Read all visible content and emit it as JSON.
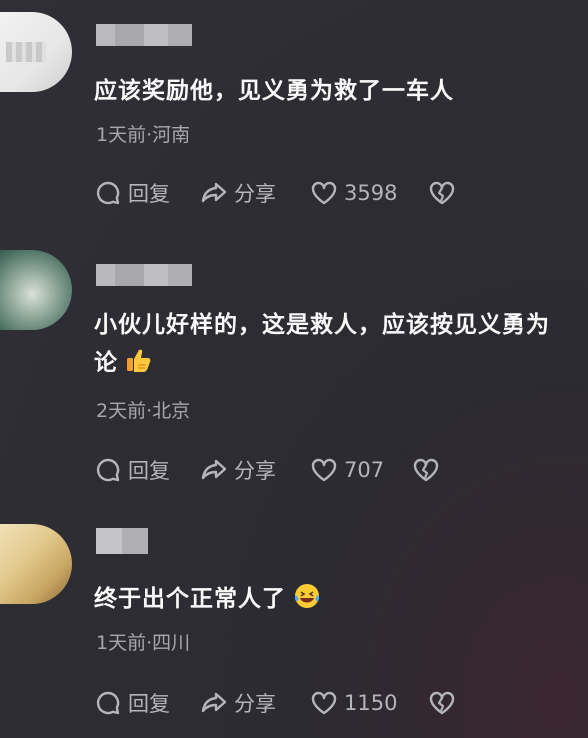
{
  "comments": [
    {
      "text": "应该奖励他，见义勇为救了一车人",
      "meta": "1天前·河南",
      "reply": "回复",
      "share": "分享",
      "likes": "3598"
    },
    {
      "text": "小伙儿好样的，这是救人，应该按见义勇为论",
      "meta": "2天前·北京",
      "reply": "回复",
      "share": "分享",
      "likes": "707",
      "emoji": "thumbs-up"
    },
    {
      "text": "终于出个正常人了",
      "meta": "1天前·四川",
      "reply": "回复",
      "share": "分享",
      "likes": "1150",
      "emoji": "laughing-tears"
    }
  ],
  "icons": {
    "reply": "comment-bubble-icon",
    "share": "share-arrow-icon",
    "like": "heart-icon",
    "dislike": "broken-heart-icon"
  }
}
